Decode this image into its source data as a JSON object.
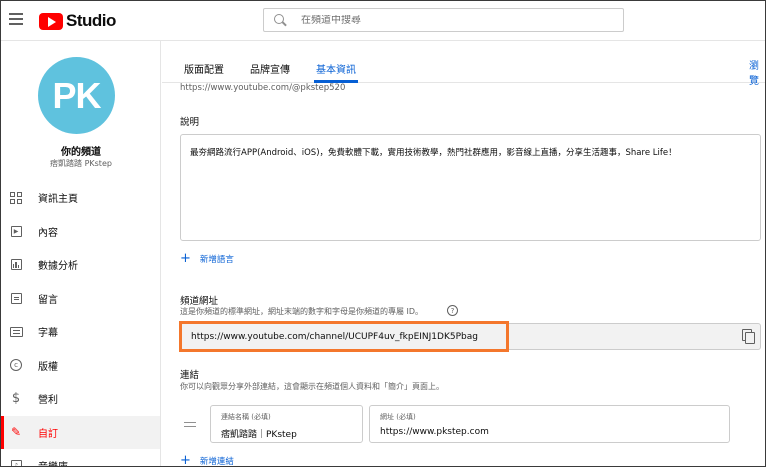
{
  "header": {
    "app_title": "Studio",
    "search_placeholder": "在頻道中搜尋"
  },
  "sidebar": {
    "avatar_text": "PK",
    "channel_title": "你的頻道",
    "channel_handle": "痞凱踏踏 PKstep",
    "items": [
      {
        "label": "資訊主頁",
        "icon": "dashboard-icon"
      },
      {
        "label": "內容",
        "icon": "content-icon"
      },
      {
        "label": "數據分析",
        "icon": "analytics-icon"
      },
      {
        "label": "留言",
        "icon": "comments-icon"
      },
      {
        "label": "字幕",
        "icon": "subtitles-icon"
      },
      {
        "label": "版權",
        "icon": "copyright-icon"
      },
      {
        "label": "營利",
        "icon": "monetization-icon"
      },
      {
        "label": "自訂",
        "icon": "customization-icon",
        "active": true
      },
      {
        "label": "音樂庫",
        "icon": "audio-library-icon"
      }
    ]
  },
  "tabs": [
    {
      "label": "版面配置"
    },
    {
      "label": "品牌宣傳"
    },
    {
      "label": "基本資訊",
      "active": true
    }
  ],
  "tab_overflow_label": "瀏覽",
  "handle_url": "https://www.youtube.com/@pkstep520",
  "description": {
    "label": "說明",
    "text": "最夯網路流行APP(Android、iOS)，免費軟體下載，實用技術教學，熱門社群應用，影音線上直播，分享生活趣事，Share Life！",
    "add_language_label": "新增語言"
  },
  "channel_url": {
    "label": "頻道網址",
    "hint": "這是你頻道的標準網址，網址末端的數字和字母是你頻道的專屬 ID。",
    "value": "https://www.youtube.com/channel/UCUPF4uv_fkpEINJ1DK5Pbag"
  },
  "links": {
    "label": "連結",
    "hint": "你可以向觀眾分享外部連結，這會顯示在頻道個人資料和「簡介」頁面上。",
    "name_field_label": "連結名稱 (必填)",
    "name_value": "痞凱踏踏｜PKstep",
    "url_field_label": "網址 (必填)",
    "url_value": "https://www.pkstep.com",
    "add_link_label": "新增連結"
  },
  "colors": {
    "accent_blue": "#065fd4",
    "brand_red": "#ff0000",
    "highlight_orange": "#f4772c",
    "avatar_bg": "#5fc2de"
  }
}
